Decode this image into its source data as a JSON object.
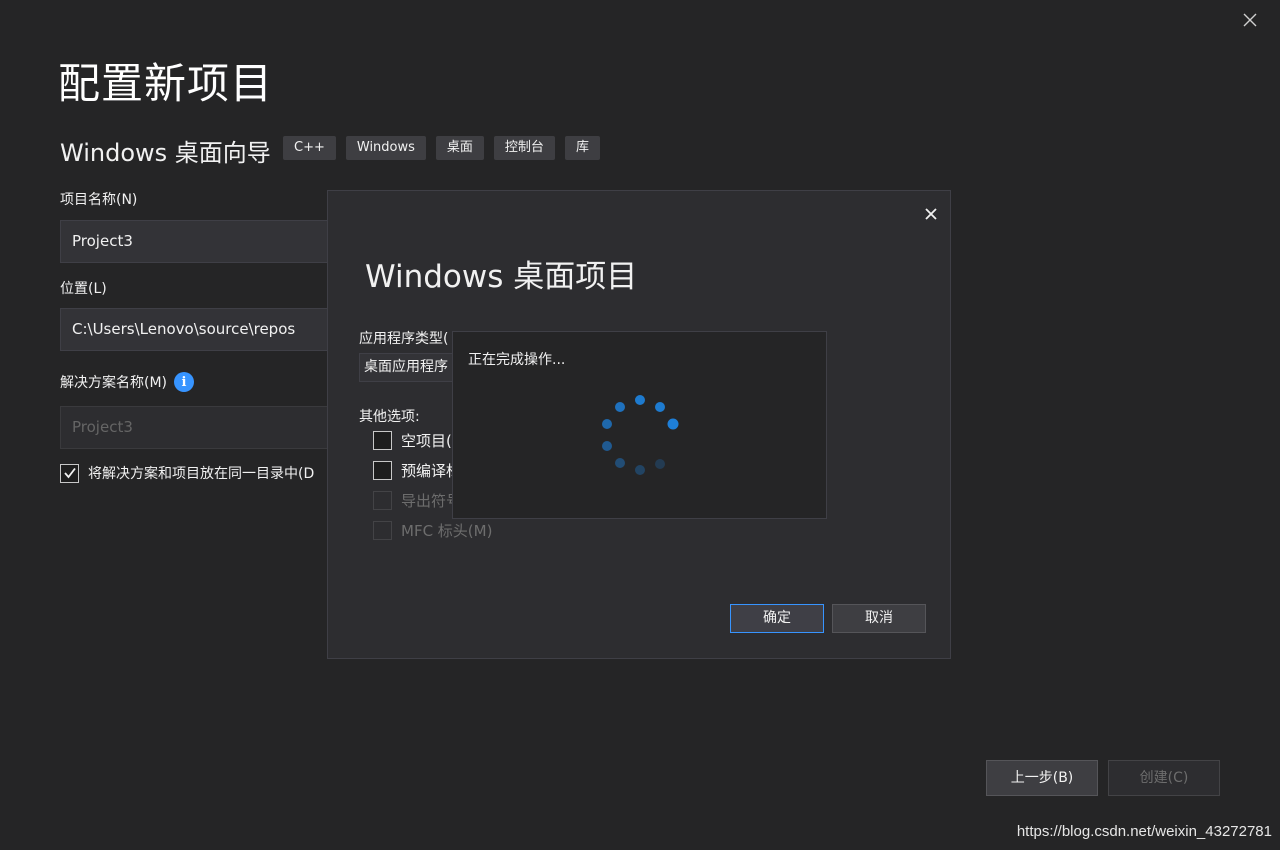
{
  "window": {
    "title": "配置新项目",
    "close_icon": "close-icon"
  },
  "template": {
    "name": "Windows 桌面向导",
    "tags": [
      "C++",
      "Windows",
      "桌面",
      "控制台",
      "库"
    ]
  },
  "form": {
    "project_name_label": "项目名称(N)",
    "project_name_value": "Project3",
    "location_label": "位置(L)",
    "location_value": "C:\\Users\\Lenovo\\source\\repos",
    "solution_name_label": "解决方案名称(M)",
    "solution_name_value": "Project3",
    "same_dir_label": "将解决方案和项目放在同一目录中(D",
    "same_dir_checked": true
  },
  "buttons": {
    "back": "上一步(B)",
    "create": "创建(C)"
  },
  "watermark": "https://blog.csdn.net/weixin_43272781",
  "dialog": {
    "title": "Windows 桌面项目",
    "app_type_label": "应用程序类型(",
    "app_type_value": "桌面应用程序",
    "other_options_label": "其他选项:",
    "options": [
      {
        "label": "空项目(",
        "enabled": true,
        "checked": false
      },
      {
        "label": "预编译标",
        "enabled": true,
        "checked": false
      },
      {
        "label": "导出符号",
        "enabled": false,
        "checked": false
      },
      {
        "label": "MFC 标头(M)",
        "enabled": false,
        "checked": false
      }
    ],
    "ok": "确定",
    "cancel": "取消"
  },
  "progress": {
    "text": "正在完成操作..."
  },
  "colors": {
    "accent": "#3794ff",
    "spinner": "#1e7fd8",
    "background": "#252526"
  }
}
